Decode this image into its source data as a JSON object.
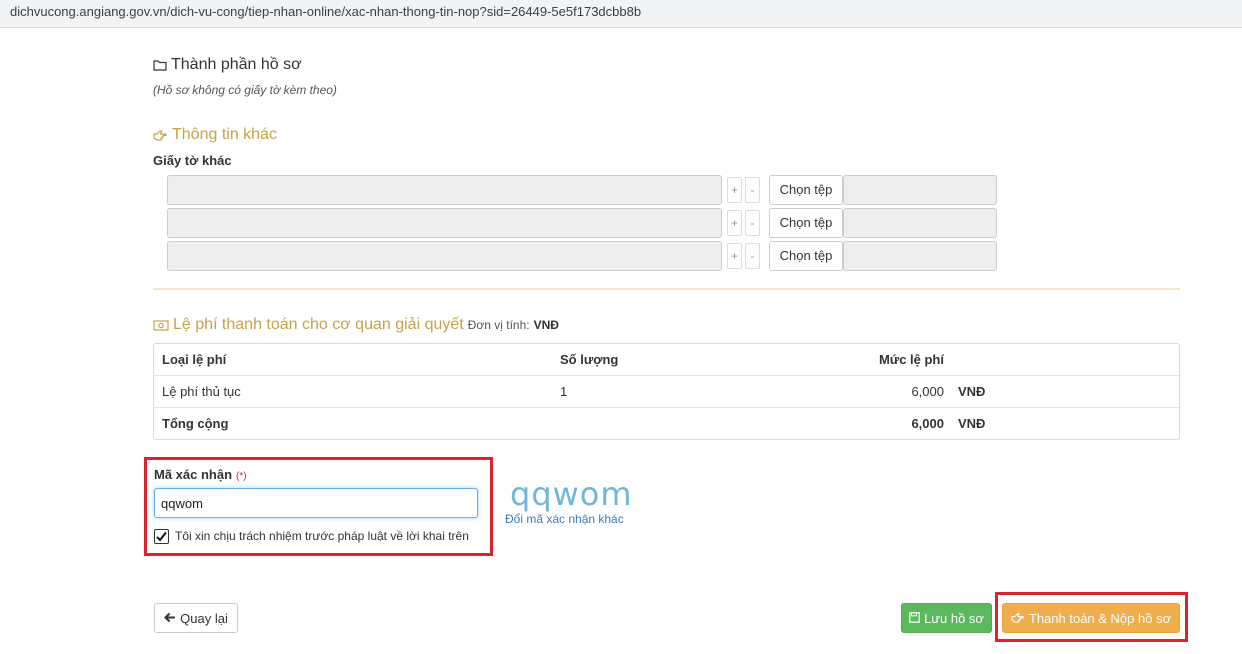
{
  "browser": {
    "url": "dichvucong.angiang.gov.vn/dich-vu-cong/tiep-nhan-online/xac-nhan-thong-tin-nop?sid=26449-5e5f173dcbb8b"
  },
  "components": {
    "title": "Thành phần hồ sơ",
    "note": "(Hồ sơ không có giấy tờ kèm theo)"
  },
  "other_info": {
    "title": "Thông tin khác",
    "docs_label": "Giấy tờ khác",
    "rows": [
      {
        "name": "",
        "plus": "+",
        "minus": "-",
        "file_button": "Chọn tệp",
        "file_name": ""
      },
      {
        "name": "",
        "plus": "+",
        "minus": "-",
        "file_button": "Chọn tệp",
        "file_name": ""
      },
      {
        "name": "",
        "plus": "+",
        "minus": "-",
        "file_button": "Chọn tệp",
        "file_name": ""
      }
    ]
  },
  "fees": {
    "title": "Lệ phí thanh toán cho cơ quan giải quyết",
    "unit_label": "Đơn vị tính:",
    "unit_value": "VNĐ",
    "headers": {
      "type": "Loại lệ phí",
      "qty": "Số lượng",
      "rate": "Mức lệ phí"
    },
    "rows": [
      {
        "type": "Lệ phí thủ tục",
        "qty": "1",
        "rate": "6,000",
        "currency": "VNĐ"
      }
    ],
    "total": {
      "label": "Tổng cộng",
      "amount": "6,000",
      "currency": "VNĐ"
    }
  },
  "captcha": {
    "label": "Mã xác nhận",
    "required": "(*)",
    "value": "qqwom",
    "image_text": "qqwom",
    "refresh_link": "Đổi mã xác nhận khác",
    "agree_text": "Tôi xin chịu trách nhiệm trước pháp luật về lời khai trên",
    "agree_checked": true
  },
  "actions": {
    "back": "Quay lại",
    "save": "Lưu hồ sơ",
    "submit": "Thanh toán & Nộp hồ sơ"
  },
  "colors": {
    "accent_orange": "#c8a24a",
    "save_green": "#5cb85c",
    "submit_orange": "#f0ad4e",
    "highlight_red": "#d9232d"
  }
}
